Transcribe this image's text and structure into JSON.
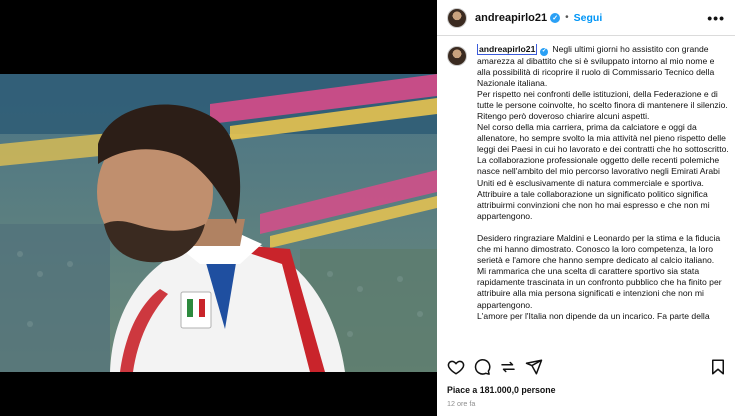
{
  "post": {
    "username": "andreapirlo21",
    "follow_label": "Segui",
    "more_label": "•••",
    "caption": {
      "username": "andreapirlo21",
      "p1": "Negli ultimi giorni ho assistito con grande amarezza al dibattito che si è sviluppato intorno al mio nome e alla possibilità di ricoprire il ruolo di Commissario Tecnico della Nazionale italiana.",
      "p2": "Per rispetto nei confronti delle istituzioni, della Federazione e di tutte le persone coinvolte, ho scelto finora di mantenere il silenzio. Ritengo però doveroso chiarire alcuni aspetti.",
      "p3": "Nel corso della mia carriera, prima da calciatore e oggi da allenatore, ho sempre svolto la mia attività nel pieno rispetto delle leggi dei Paesi in cui ho lavorato e dei contratti che ho sottoscritto. La collaborazione professionale oggetto delle recenti polemiche nasce nell'ambito del mio percorso lavorativo negli Emirati Arabi Uniti ed è esclusivamente di natura commerciale e sportiva.",
      "p4": "Attribuire a tale collaborazione un significato politico significa attribuirmi convinzioni che non ho mai espresso e che non mi appartengono.",
      "p5": "Desidero ringraziare Maldini e Leonardo per la stima e la fiducia che mi hanno dimostrato. Conosco la loro competenza, la loro serietà e l'amore che hanno sempre dedicato al calcio italiano.",
      "p6": "Mi rammarica che una scelta di carattere sportivo sia stata rapidamente trascinata in un confronto pubblico che ha finito per attribuire alla mia persona significati e intenzioni che non mi appartengono.",
      "p7": "L'amore per l'Italia non dipende da un incarico. Fa parte della"
    },
    "likes": "Piace a 181.000,0 persone",
    "time": "12 ore fa"
  },
  "icons": {
    "like": "heart-icon",
    "comment": "comment-icon",
    "share": "share-icon",
    "send": "send-icon",
    "save": "bookmark-icon",
    "verified": "verified-badge-icon"
  },
  "photo": {
    "badge_text": "ITALIA"
  }
}
